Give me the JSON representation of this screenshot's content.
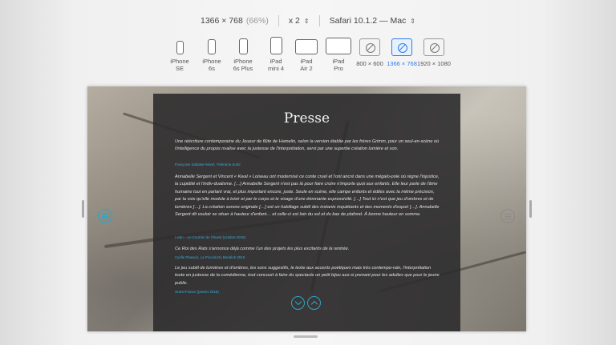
{
  "toolbar": {
    "resolution": "1366 × 768",
    "zoom": "(66%)",
    "scale": "x 2",
    "browser": "Safari 10.1.2 — Mac"
  },
  "devices": [
    {
      "label": "iPhone\nSE"
    },
    {
      "label": "iPhone\n6s"
    },
    {
      "label": "iPhone\n6s Plus"
    },
    {
      "label": "iPad\nmini 4"
    },
    {
      "label": "iPad\nAir 2"
    },
    {
      "label": "iPad\nPro"
    },
    {
      "label": "800 × 600"
    },
    {
      "label": "1366 × 768",
      "selected": true
    },
    {
      "label": "1920 × 1080"
    }
  ],
  "page": {
    "title": "Presse",
    "quotes": [
      {
        "text": "Une réécriture contemporaine du Joueur de flûte de Hamelin, selon la version établie par les frères Grimm, pour un seul-en-scène où l'intelligence du propos rivalise avec la justesse de l'interprétation, servi par une superbe création lumière et son.",
        "source": "Françoise Sabatier-Morel, Télérama Sortir"
      },
      {
        "text": "Annabelle Sergent et Vincent « Kwal » Loiseau ont modernisé ce conte cruel et l'ont ancré dans une mégalo-pole où règne l'injustice, la cupidité et l'indiv-dualisme. […] Annabelle Sergent n'est pas là pour faire croire n'importe quoi aux enfants. Elle leur parle de l'âme humaine tout en parlant vrai, et plus important encore, juste. Seule en scène, elle campe enfants et édiles avec la même précision, par la voix qu'elle module à loisir et par le corps et le visage d'une étonnante expressivité. […] Tout ici n'est que jeu d'ombres et de lumières […]. La création sonore originale […] est un habillage subtil des instants inquiétants et des moments d'espoir […]. Annabelle Sergent dit vouloir se situer à hauteur d'enfant… et celle-ci est loin du sol et du bas de plafond. À bonne hauteur en somme.",
        "source": "Lelan – Le Courrier de l'Ouest (octobre 2015)"
      },
      {
        "text": "Ce Roi des Rats s'annonce déjà comme l'un des projets les plus excitants de la rentrée.",
        "source": "Cyrille Planson, La Piccola Du Bendioh 2015"
      },
      {
        "text": "Le jeu subtil de lumières et d'ombres, les sons suggestifs, le texte aux accents poétiques mais très contempo-rain, l'interprétation toute en justesse de la comédienne, tout concourt à faire du spectacle un petit bijou aus-si prenant pour les adultes que pour le jeune public.",
        "source": "Ouest France (janvier 2015)"
      }
    ]
  },
  "colors": {
    "accent": "#2aa7c8",
    "selected": "#2b7de9",
    "panel": "#2d2c2e"
  }
}
